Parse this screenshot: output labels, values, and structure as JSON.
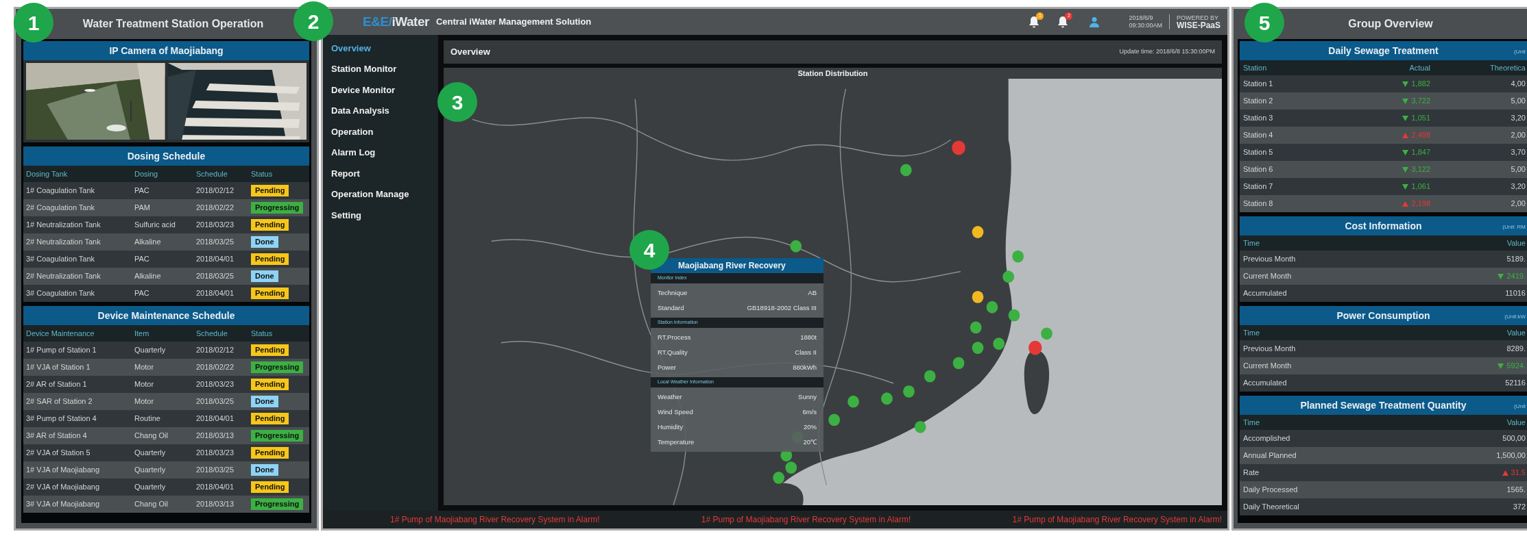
{
  "callouts": [
    "1",
    "2",
    "3",
    "4",
    "5"
  ],
  "left_panel": {
    "title": "Water Treatment Station Operation",
    "camera": {
      "title": "IP Camera of Maojiabang"
    },
    "tables": [
      {
        "title": "Dosing Schedule",
        "columns": [
          "Dosing Tank",
          "Dosing",
          "Schedule",
          "Status"
        ],
        "rows": [
          {
            "cells": [
              "1# Coagulation Tank",
              "PAC",
              "2018/02/12"
            ],
            "status": {
              "label": "Pending",
              "color": "#f6c71a"
            }
          },
          {
            "cells": [
              "2# Coagulation Tank",
              "PAM",
              "2018/02/22"
            ],
            "status": {
              "label": "Progressing",
              "color": "#3cb043"
            }
          },
          {
            "cells": [
              "1# Neutralization Tank",
              "Sulfuric acid",
              "2018/03/23"
            ],
            "status": {
              "label": "Pending",
              "color": "#f6c71a"
            }
          },
          {
            "cells": [
              "2# Neutralization Tank",
              "Alkaline",
              "2018/03/25"
            ],
            "status": {
              "label": "Done",
              "color": "#8fd3f4"
            }
          },
          {
            "cells": [
              "3# Coagulation Tank",
              "PAC",
              "2018/04/01"
            ],
            "status": {
              "label": "Pending",
              "color": "#f6c71a"
            }
          },
          {
            "cells": [
              "2# Neutralization Tank",
              "Alkaline",
              "2018/03/25"
            ],
            "status": {
              "label": "Done",
              "color": "#8fd3f4"
            }
          },
          {
            "cells": [
              "3# Coagulation Tank",
              "PAC",
              "2018/04/01"
            ],
            "status": {
              "label": "Pending",
              "color": "#f6c71a"
            }
          }
        ]
      },
      {
        "title": "Device Maintenance Schedule",
        "columns": [
          "Device Maintenance",
          "Item",
          "Schedule",
          "Status"
        ],
        "rows": [
          {
            "cells": [
              "1# Pump of Station 1",
              "Quarterly",
              "2018/02/12"
            ],
            "status": {
              "label": "Pending",
              "color": "#f6c71a"
            }
          },
          {
            "cells": [
              "1# VJA of Station 1",
              "Motor",
              "2018/02/22"
            ],
            "status": {
              "label": "Progressing",
              "color": "#3cb043"
            }
          },
          {
            "cells": [
              "2# AR of Station 1",
              "Motor",
              "2018/03/23"
            ],
            "status": {
              "label": "Pending",
              "color": "#f6c71a"
            }
          },
          {
            "cells": [
              "2# SAR of Station 2",
              "Motor",
              "2018/03/25"
            ],
            "status": {
              "label": "Done",
              "color": "#8fd3f4"
            }
          },
          {
            "cells": [
              "3# Pump of Station 4",
              "Routine",
              "2018/04/01"
            ],
            "status": {
              "label": "Pending",
              "color": "#f6c71a"
            }
          },
          {
            "cells": [
              "3# AR of Station 4",
              "Chang Oil",
              "2018/03/13"
            ],
            "status": {
              "label": "Progressing",
              "color": "#3cb043"
            }
          },
          {
            "cells": [
              "2# VJA of Station 5",
              "Quarterly",
              "2018/03/23"
            ],
            "status": {
              "label": "Pending",
              "color": "#f6c71a"
            }
          },
          {
            "cells": [
              "1# VJA of Maojiabang",
              "Quarterly",
              "2018/03/25"
            ],
            "status": {
              "label": "Done",
              "color": "#8fd3f4"
            }
          },
          {
            "cells": [
              "2# VJA of Maojiabang",
              "Quarterly",
              "2018/04/01"
            ],
            "status": {
              "label": "Pending",
              "color": "#f6c71a"
            }
          },
          {
            "cells": [
              "3# VJA of Maojiabang",
              "Chang Oil",
              "2018/03/13"
            ],
            "status": {
              "label": "Progressing",
              "color": "#3cb043"
            }
          }
        ]
      }
    ]
  },
  "header": {
    "logo_left": "E&E/",
    "logo_right": "iWater",
    "title": "Central iWater Management Solution",
    "notifications": [
      {
        "count": "1",
        "color": "#f6a91a"
      },
      {
        "count": "2",
        "color": "#e53935"
      }
    ],
    "date": "2018/6/9",
    "time": "09:30:00AM",
    "powered_by": "POWERED BY",
    "platform": "WISE-PaaS"
  },
  "nav": [
    {
      "label": "Overview",
      "selected": true
    },
    {
      "label": "Station Monitor",
      "selected": false
    },
    {
      "label": "Device Monitor",
      "selected": false
    },
    {
      "label": "Data Analysis",
      "selected": false
    },
    {
      "label": "Operation",
      "selected": false
    },
    {
      "label": "Alarm Log",
      "selected": false
    },
    {
      "label": "Report",
      "selected": false
    },
    {
      "label": "Operation Manage",
      "selected": false
    },
    {
      "label": "Setting",
      "selected": false
    }
  ],
  "overview": {
    "title": "Overview",
    "update_time": "Update time: 2018/6/8 15:30:00PM",
    "map_title": "Station Distribution",
    "popup": {
      "title": "Maojiabang River Recovery",
      "sections": [
        {
          "heading": "Monitor Index",
          "rows": [
            [
              "Technique",
              "AB"
            ],
            [
              "Standard",
              "GB18918-2002 Class III"
            ]
          ]
        },
        {
          "heading": "Station Information",
          "rows": [
            [
              "RT.Process",
              "1880t"
            ],
            [
              "RT.Quality",
              "Class II"
            ],
            [
              "Power",
              "880kWh"
            ]
          ]
        },
        {
          "heading": "Local Weather Information",
          "rows": [
            [
              "Weather",
              "Sunny"
            ],
            [
              "Wind Speed",
              "6m/s"
            ],
            [
              "Humidity",
              "20%"
            ],
            [
              "Temperature",
              "20℃"
            ]
          ]
        }
      ]
    },
    "ticker": [
      "1# Pump of Maojiabang River Recovery System in Alarm!",
      "1# Pump of Maojiabang River Recovery System in Alarm!",
      "1# Pump of Maojiabang River Recovery System in Alarm!"
    ]
  },
  "right_panel": {
    "title": "Group Overview",
    "tables": [
      {
        "title": "Daily Sewage Treatment",
        "unit": "(Unit",
        "columns": [
          "Station",
          "Actual",
          "Theoretica"
        ],
        "rows": [
          {
            "cells": [
              "Station 1",
              "1,882",
              "4,00"
            ],
            "rising": false
          },
          {
            "cells": [
              "Station 2",
              "3,722",
              "5,00"
            ],
            "rising": false
          },
          {
            "cells": [
              "Station 3",
              "1,051",
              "3,20"
            ],
            "rising": false
          },
          {
            "cells": [
              "Station 4",
              "2,498",
              "2,00"
            ],
            "rising": true
          },
          {
            "cells": [
              "Station 5",
              "1,847",
              "3,70"
            ],
            "rising": false
          },
          {
            "cells": [
              "Station 6",
              "3,122",
              "5,00"
            ],
            "rising": false
          },
          {
            "cells": [
              "Station 7",
              "1,061",
              "3,20"
            ],
            "rising": false
          },
          {
            "cells": [
              "Station 8",
              "2,198",
              "2,00"
            ],
            "rising": true
          }
        ]
      },
      {
        "title": "Cost Information",
        "unit": "(Unit: RM",
        "columns": [
          "Time",
          "Value"
        ],
        "rows": [
          {
            "cells": [
              "Previous Month",
              "5189."
            ]
          },
          {
            "cells": [
              "Current Month",
              "2419."
            ],
            "rising": false
          },
          {
            "cells": [
              "Accumulated",
              "11016"
            ]
          }
        ]
      },
      {
        "title": "Power Consumption",
        "unit": "(Unit:kW",
        "columns": [
          "Time",
          "Value"
        ],
        "rows": [
          {
            "cells": [
              "Previous Month",
              "8289."
            ]
          },
          {
            "cells": [
              "Current Month",
              "5924."
            ],
            "rising": false
          },
          {
            "cells": [
              "Accumulated",
              "52116"
            ]
          }
        ]
      },
      {
        "title": "Planned Sewage Treatment Quantity",
        "unit": "(Unit",
        "columns": [
          "Time",
          "Value"
        ],
        "rows": [
          {
            "cells": [
              "Accomplished",
              "500,00"
            ]
          },
          {
            "cells": [
              "Annual Planned",
              "1,500,00"
            ]
          },
          {
            "cells": [
              "Rate",
              "31.5"
            ],
            "rising": true
          },
          {
            "cells": [
              "Daily Processed",
              "1565."
            ]
          },
          {
            "cells": [
              "Daily Theoretical",
              "372"
            ]
          }
        ]
      }
    ]
  }
}
